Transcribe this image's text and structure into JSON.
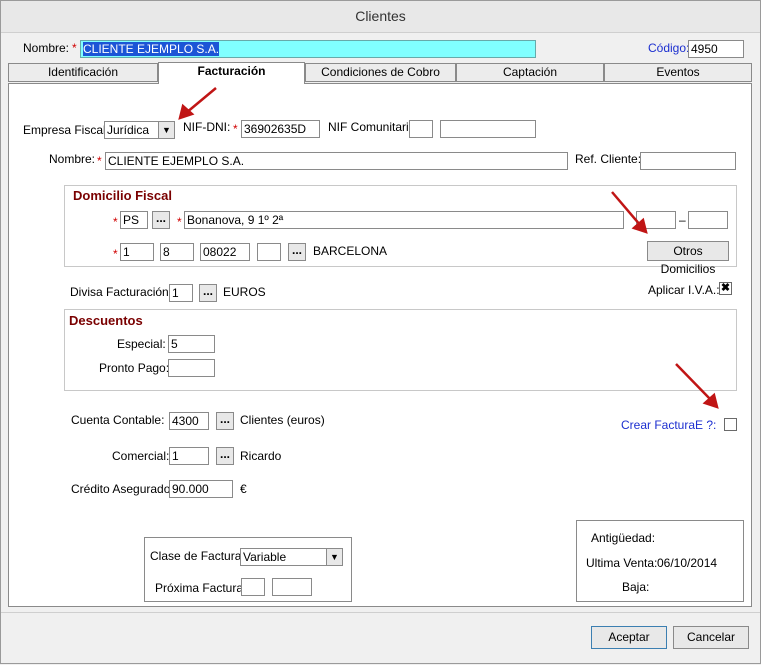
{
  "window": {
    "title": "Clientes"
  },
  "header": {
    "nombre_label": "Nombre:",
    "nombre_value": "CLIENTE EJEMPLO S.A.",
    "codigo_label": "Código:",
    "codigo_value": "4950"
  },
  "tabs": [
    {
      "label": "Identificación"
    },
    {
      "label": "Facturación"
    },
    {
      "label": "Condiciones de Cobro"
    },
    {
      "label": "Captación"
    },
    {
      "label": "Eventos"
    }
  ],
  "facturacion": {
    "empresa_fiscal_label": "Empresa Fiscal:",
    "empresa_fiscal_value": "Jurídica",
    "nif_label": "NIF-DNI:",
    "nif_value": "36902635D",
    "nif_comunitario_label": "NIF Comunitario:",
    "nif_comunitario_value_1": "",
    "nif_comunitario_value_2": "",
    "nombre_label": "Nombre:",
    "nombre_value": "CLIENTE EJEMPLO S.A.",
    "ref_cliente_label": "Ref. Cliente:",
    "ref_cliente_value": ""
  },
  "domicilio": {
    "title": "Domicilio Fiscal",
    "via_tipo": "PS",
    "direccion": "Bonanova, 9 1º 2ª",
    "extra_1": "",
    "dash": "–",
    "extra_2": "",
    "pais": "1",
    "provincia": "8",
    "cp": "08022",
    "poblacion_code": "",
    "poblacion_name": "BARCELONA",
    "otros_button": "Otros Domicilios"
  },
  "divisa": {
    "label": "Divisa Facturación:",
    "value": "1",
    "name": "EUROS",
    "aplicar_iva_label": "Aplicar I.V.A.:",
    "aplicar_iva_checked": "✖"
  },
  "descuentos": {
    "title": "Descuentos",
    "especial_label": "Especial:",
    "especial_value": "5",
    "pronto_pago_label": "Pronto Pago:",
    "pronto_pago_value": ""
  },
  "cuenta": {
    "label": "Cuenta Contable:",
    "value": "4300",
    "name": "Clientes (euros)",
    "crear_factura_label": "Crear FacturaE ?:"
  },
  "comercial": {
    "label": "Comercial:",
    "value": "1",
    "name": "Ricardo"
  },
  "credito": {
    "label": "Crédito Asegurado:",
    "value": "90.000",
    "currency": "€"
  },
  "clase_factura": {
    "label": "Clase de Factura:",
    "value": "Variable",
    "proxima_label": "Próxima Factura:",
    "proxima_1": "",
    "proxima_2": ""
  },
  "info": {
    "antiguedad_label": "Antigüedad:",
    "antiguedad_value": "",
    "ultima_venta_label": "Ultima Venta:",
    "ultima_venta_value": "06/10/2014",
    "baja_label": "Baja:",
    "baja_value": ""
  },
  "buttons": {
    "aceptar": "Aceptar",
    "cancelar": "Cancelar"
  },
  "colors": {
    "highlight": "#80ffff",
    "arrow": "#c01515",
    "title_red": "#7a0000",
    "link_blue": "#1c2fd0"
  }
}
